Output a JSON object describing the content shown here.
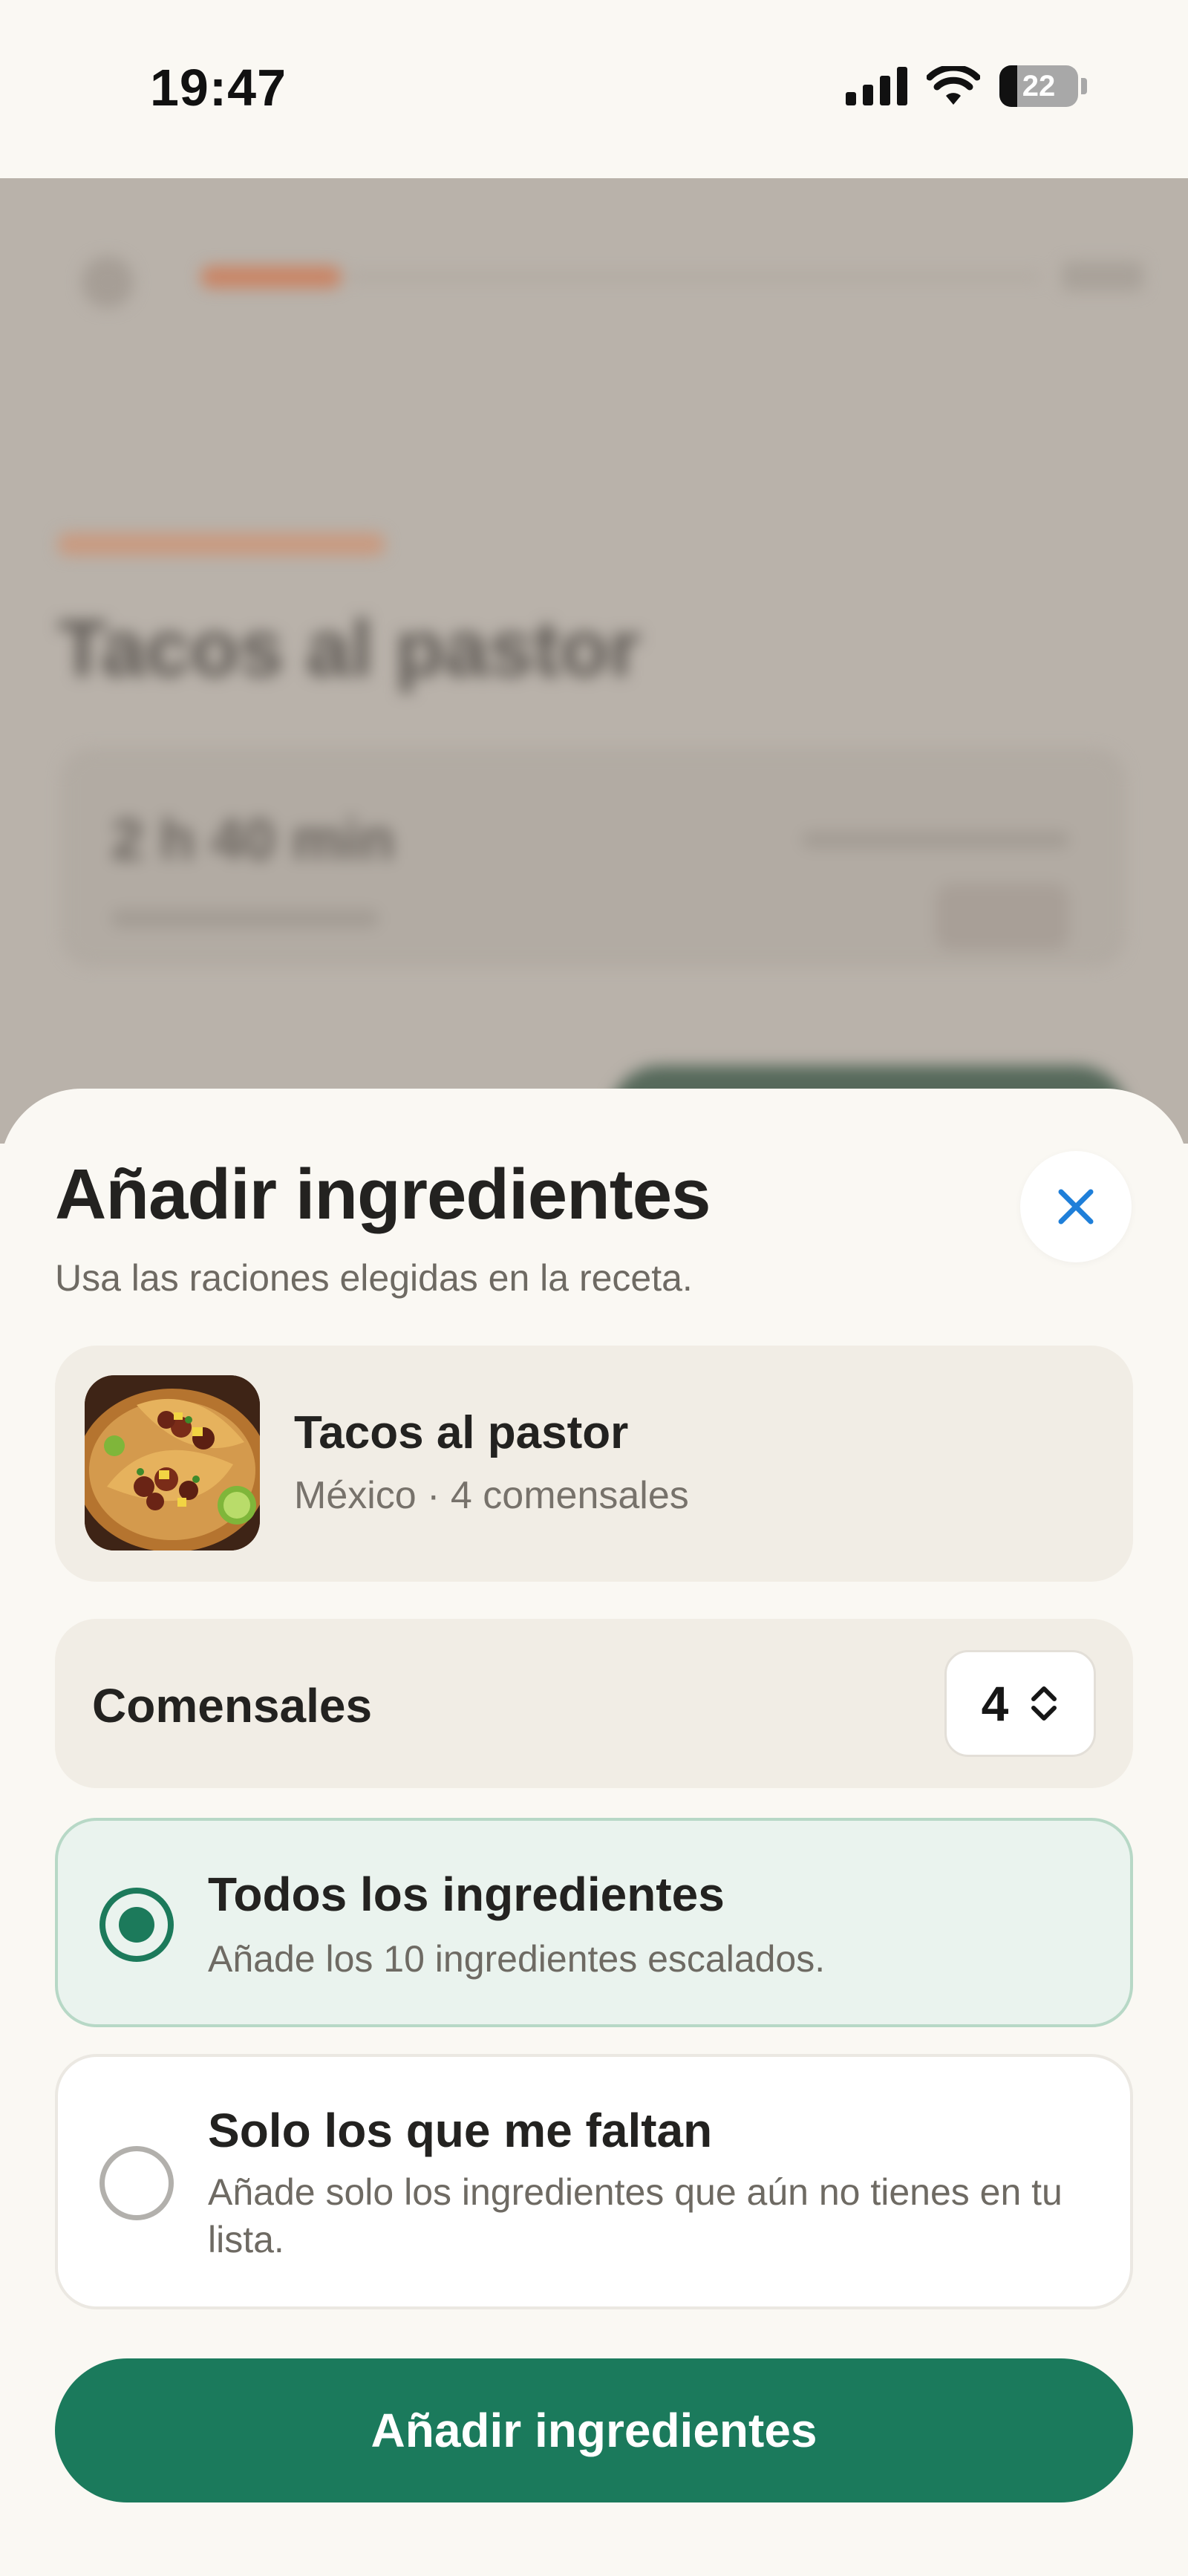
{
  "status_bar": {
    "time": "19:47",
    "battery": "22"
  },
  "background_page": {
    "title": "Tacos al pastor",
    "time": "2 h 40 min"
  },
  "sheet": {
    "title": "Añadir ingredientes",
    "subtitle": "Usa las raciones elegidas en la receta.",
    "close_icon": "close-icon"
  },
  "recipe": {
    "name": "Tacos al pastor",
    "meta": "México · 4 comensales"
  },
  "diners": {
    "label": "Comensales",
    "value": "4"
  },
  "options": [
    {
      "title": "Todos los ingredientes",
      "description": "Añade los 10 ingredientes escalados.",
      "selected": true
    },
    {
      "title": "Solo los que me faltan",
      "description": "Añade solo los ingredientes que aún no tienes en tu lista.",
      "selected": false
    }
  ],
  "primary_button": {
    "label": "Añadir ingredientes"
  },
  "colors": {
    "accent": "#1b7a5c",
    "close": "#1f7fd9",
    "sheet_bg": "#faf8f3",
    "card_bg": "#f1ede5"
  }
}
